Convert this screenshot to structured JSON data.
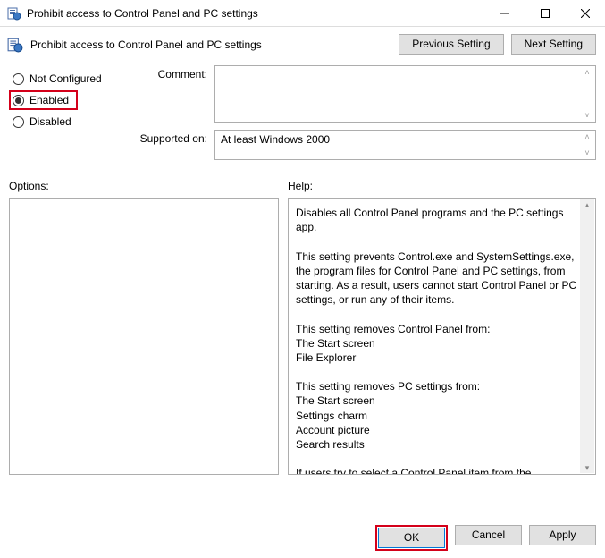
{
  "window": {
    "title": "Prohibit access to Control Panel and PC settings"
  },
  "header": {
    "title": "Prohibit access to Control Panel and PC settings",
    "prev": "Previous Setting",
    "next": "Next Setting"
  },
  "state": {
    "not_configured": "Not Configured",
    "enabled": "Enabled",
    "disabled": "Disabled",
    "selected": "enabled"
  },
  "form": {
    "comment_label": "Comment:",
    "comment_value": "",
    "supported_label": "Supported on:",
    "supported_value": "At least Windows 2000"
  },
  "sections": {
    "options": "Options:",
    "help": "Help:"
  },
  "help_text": "Disables all Control Panel programs and the PC settings app.\n\nThis setting prevents Control.exe and SystemSettings.exe, the program files for Control Panel and PC settings, from starting. As a result, users cannot start Control Panel or PC settings, or run any of their items.\n\nThis setting removes Control Panel from:\nThe Start screen\nFile Explorer\n\nThis setting removes PC settings from:\nThe Start screen\nSettings charm\nAccount picture\nSearch results\n\nIf users try to select a Control Panel item from the Properties item on a context menu, a message appears explaining that a setting prevents the action.",
  "footer": {
    "ok": "OK",
    "cancel": "Cancel",
    "apply": "Apply"
  }
}
